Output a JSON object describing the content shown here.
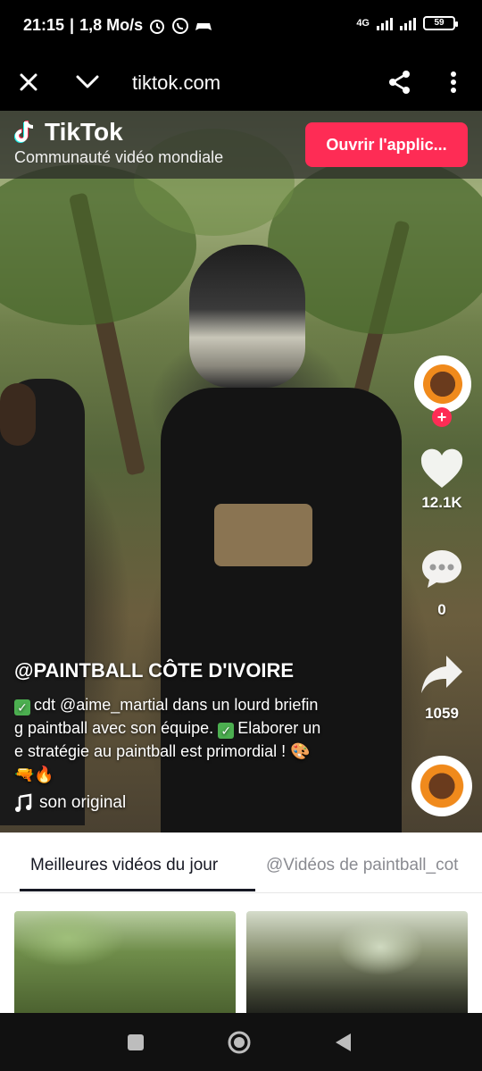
{
  "status_bar": {
    "time": "21:15",
    "data_rate": "1,8 Mo/s",
    "network": "4G",
    "battery": "59"
  },
  "browser": {
    "url": "tiktok.com",
    "icons": [
      "close-icon",
      "chevron-down-icon",
      "share-icon",
      "more-vertical-icon"
    ]
  },
  "tiktok_header": {
    "brand": "TikTok",
    "tagline": "Communauté vidéo mondiale",
    "open_app_label": "Ouvrir l'applic..."
  },
  "video": {
    "username": "@PAINTBALL CÔTE D'IVOIRE",
    "description_line1": "cdt @aime_martial dans un lourd briefin",
    "description_line2": "g paintball avec son équipe.",
    "description_line2b": "Elaborer un",
    "description_line3": "e stratégie au paintball est primordial ! 🎨",
    "description_line4": "🔫🔥",
    "sound": "son original",
    "likes": "12.1K",
    "comments": "0",
    "shares": "1059"
  },
  "tabs": {
    "active": "Meilleures vidéos du jour",
    "inactive": "@Vidéos de paintball_cot"
  },
  "colors": {
    "accent": "#fe2c55",
    "tab_active": "#161823",
    "tab_inactive": "#8a8b91",
    "check": "#4caf50"
  }
}
